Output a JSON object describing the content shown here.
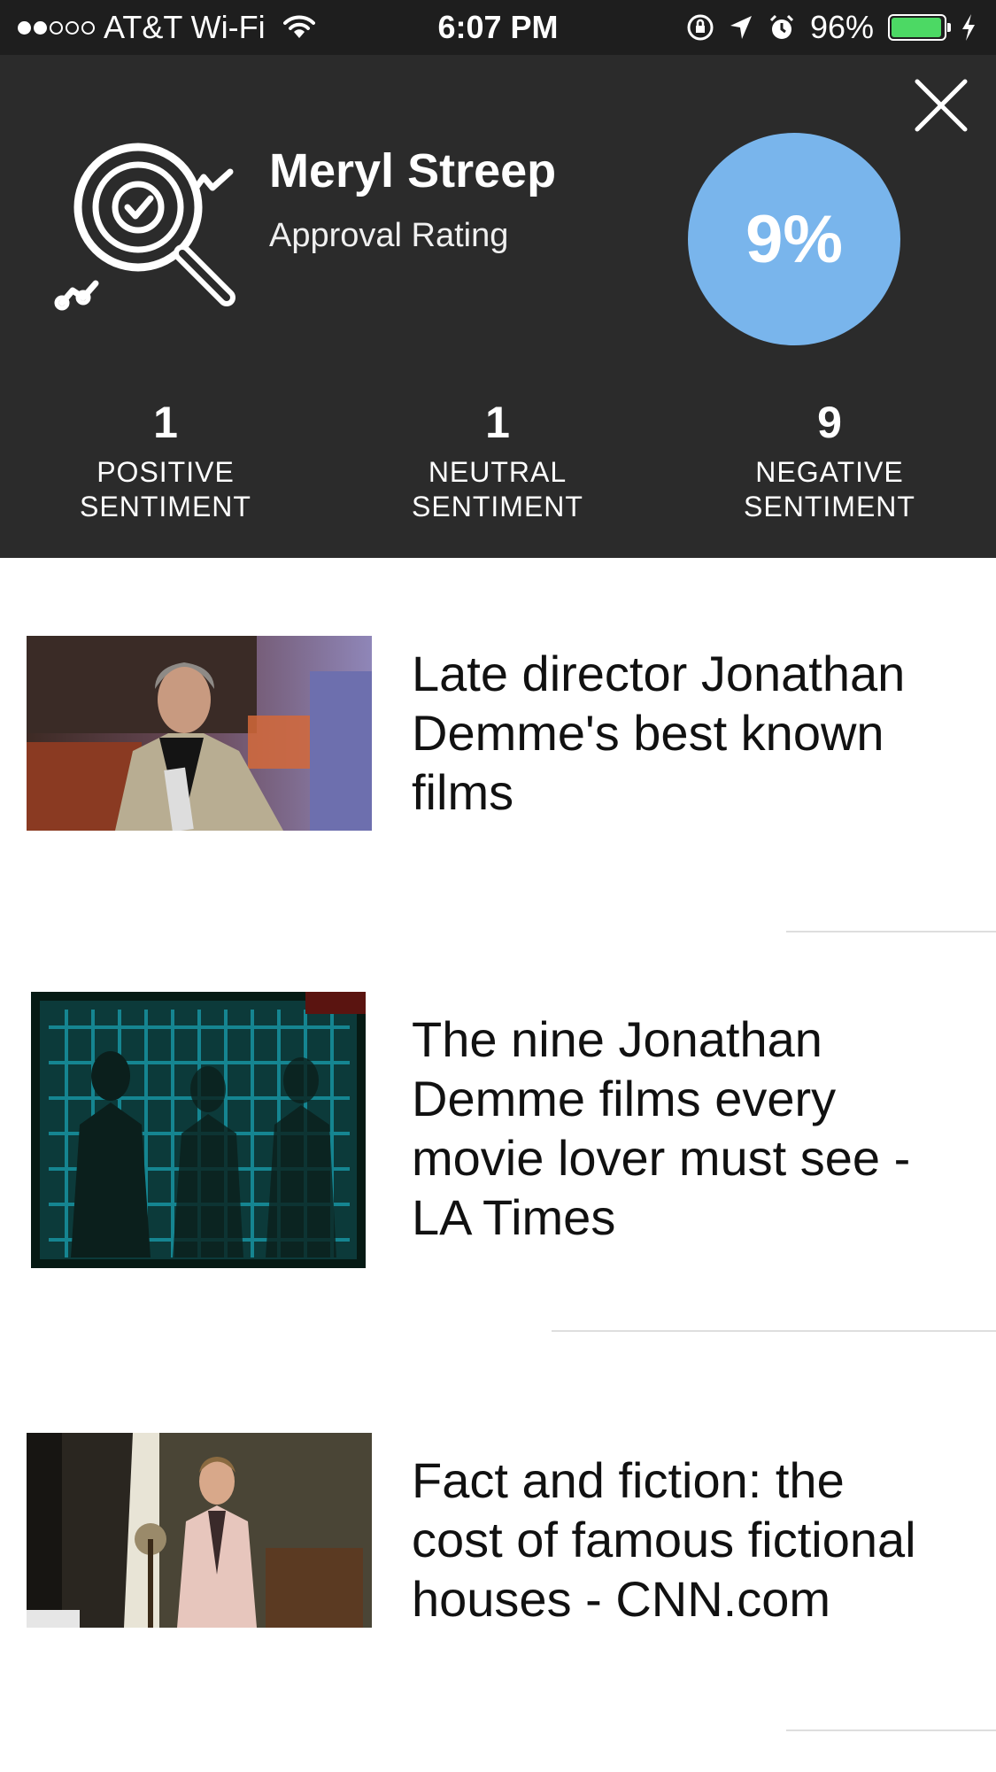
{
  "status_bar": {
    "carrier": "AT&T Wi-Fi",
    "time": "6:07 PM",
    "battery": "96%",
    "signal_bars_filled": 2,
    "signal_bars_total": 5,
    "battery_level": 0.96,
    "battery_color": "#4cd964"
  },
  "header": {
    "name": "Meryl Streep",
    "subtitle": "Approval Rating",
    "rating": "9%",
    "rating_color": "#79b5ec",
    "background": "#2b2b2b",
    "close_icon": "close-icon",
    "brand_icon": "magnifier-checkmark-trend-icon"
  },
  "sentiments": [
    {
      "count": "1",
      "label_line1": "POSITIVE",
      "label_line2": "SENTIMENT"
    },
    {
      "count": "1",
      "label_line1": "NEUTRAL",
      "label_line2": "SENTIMENT"
    },
    {
      "count": "9",
      "label_line1": "NEGATIVE",
      "label_line2": "SENTIMENT"
    }
  ],
  "articles": [
    {
      "title": "Late director Jonathan Demme's best known films",
      "image": "photo-man-holding-award"
    },
    {
      "title": "The nine Jonathan Demme films every movie lover must see - LA Times",
      "image": "photo-teal-figures-behind-grid"
    },
    {
      "title": "Fact and fiction: the cost of famous fictional houses - CNN.com",
      "image": "photo-man-in-pink-suit-interior"
    }
  ]
}
